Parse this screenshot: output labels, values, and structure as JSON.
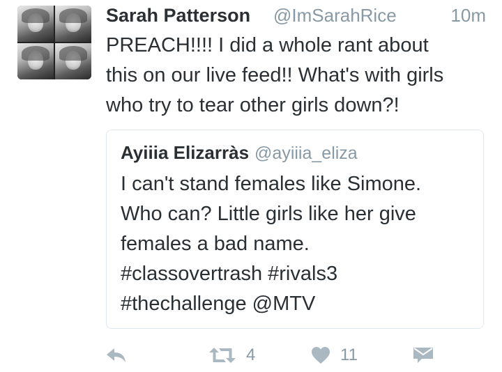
{
  "tweet": {
    "author_name": "Sarah Patterson",
    "author_handle": "@ImSarahRice",
    "timestamp": "10m",
    "text_lines": [
      "PREACH!!!! I did a whole rant about",
      "this on our live feed!! What's with girls",
      "who try to tear other girls down?!"
    ],
    "avatar_icon": "profile-photo-collage"
  },
  "quoted_tweet": {
    "author_name": "Ayiiia Elizarràs",
    "author_handle": "@ayiiia_eliza",
    "text_lines": [
      "I can't stand females like Simone.",
      "Who can? Little girls like her give",
      "females a bad name.",
      "#classovertrash #rivals3",
      "#thechallenge @MTV"
    ]
  },
  "actions": {
    "reply_icon": "reply-icon",
    "retweet_icon": "retweet-icon",
    "retweet_count": "4",
    "like_icon": "heart-icon",
    "like_count": "11",
    "dm_icon": "direct-message-icon"
  },
  "colors": {
    "text": "#292f33",
    "secondary": "#8899a6",
    "icon": "#aab8c2",
    "border": "#e1e8ed"
  }
}
